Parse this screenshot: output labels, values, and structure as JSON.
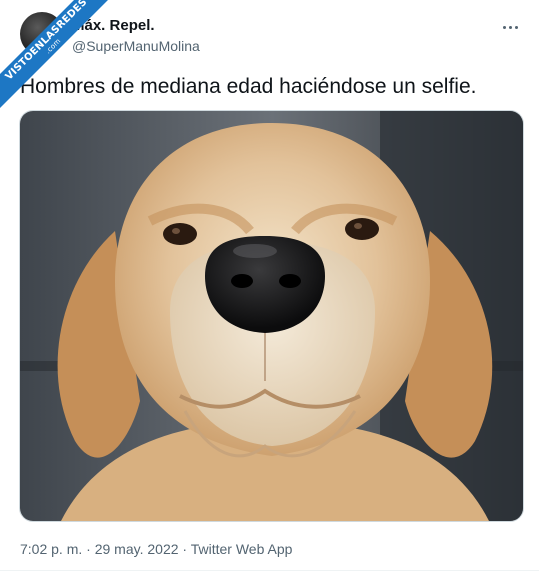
{
  "watermark": {
    "line1": "VISTOENLASREDES",
    "line2": ".com"
  },
  "author": {
    "display_name": "Máx. Repel.",
    "handle": "@SuperManuMolina"
  },
  "tweet": {
    "text": "Hombres de mediana edad haciéndose un selfie."
  },
  "meta": {
    "time": "7:02 p. m.",
    "separator1": " · ",
    "date": "29 may. 2022",
    "separator2": " · ",
    "client": "Twitter Web App"
  },
  "icons": {
    "more": "more-horizontal-icon"
  },
  "colors": {
    "text": "#0f1419",
    "secondary": "#536471",
    "watermark": "#1d77c4",
    "border": "#cfd9de"
  }
}
